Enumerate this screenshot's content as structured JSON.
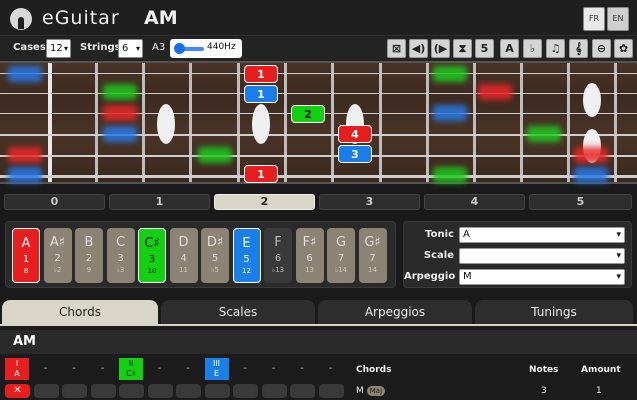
{
  "header": {
    "app_title": "eGuitar",
    "current_key": "AM",
    "lang_fr": "FR",
    "lang_en": "EN"
  },
  "toolbar": {
    "cases_label": "Cases",
    "cases_value": "12",
    "strings_label": "Strings",
    "strings_value": "6",
    "tuning_note": "A3",
    "tuning_freq": "440Hz",
    "tool_icons": [
      "mute-icon",
      "speaker-left-icon",
      "speaker-right-icon",
      "hourglass-icon",
      "number-5-icon",
      "letter-a-icon",
      "flat-icon",
      "music-note-icon",
      "treble-clef-icon",
      "guitar-icon",
      "gear-icon"
    ],
    "tool_glyphs": [
      "⊠",
      "◀)",
      "(▶",
      "⧗",
      "5",
      "A",
      "♭",
      "♫",
      "𝄞",
      "⊖",
      "✿"
    ]
  },
  "positions": [
    "0",
    "1",
    "2",
    "3",
    "4",
    "5"
  ],
  "active_position": "2",
  "fretboard_notes": [
    {
      "label": "1",
      "color": "red"
    },
    {
      "label": "1",
      "color": "blue"
    },
    {
      "label": "2",
      "color": "green"
    },
    {
      "label": "4",
      "color": "red"
    },
    {
      "label": "3",
      "color": "blue"
    },
    {
      "label": "1",
      "color": "red"
    }
  ],
  "notes": [
    {
      "name": "A",
      "degree": "1",
      "interval": "8",
      "style": "red"
    },
    {
      "name": "A♯",
      "degree": "2",
      "interval": "♭2",
      "style": "tan"
    },
    {
      "name": "B",
      "degree": "2",
      "interval": "9",
      "style": "tan"
    },
    {
      "name": "C",
      "degree": "3",
      "interval": "♭3",
      "style": "tan"
    },
    {
      "name": "C♯",
      "degree": "3",
      "interval": "10",
      "style": "green"
    },
    {
      "name": "D",
      "degree": "4",
      "interval": "11",
      "style": "tan"
    },
    {
      "name": "D♯",
      "degree": "5",
      "interval": "♭5",
      "style": "tan"
    },
    {
      "name": "E",
      "degree": "5",
      "interval": "12",
      "style": "blue"
    },
    {
      "name": "F",
      "degree": "6",
      "interval": "♭13",
      "style": "dark"
    },
    {
      "name": "F♯",
      "degree": "6",
      "interval": "13",
      "style": "tan"
    },
    {
      "name": "G",
      "degree": "7",
      "interval": "♭14",
      "style": "tan"
    },
    {
      "name": "G♯",
      "degree": "7",
      "interval": "14",
      "style": "tan"
    }
  ],
  "selects": {
    "tonic_label": "Tonic",
    "tonic_value": "A",
    "scale_label": "Scale",
    "scale_value": "",
    "arpeggio_label": "Arpeggio",
    "arpeggio_value": "M"
  },
  "tabs": [
    "Chords",
    "Scales",
    "Arpeggios",
    "Tunings"
  ],
  "active_tab": "Chords",
  "chord": {
    "name": "AM",
    "degrees": [
      {
        "roman": "I",
        "note": "A",
        "color": "red"
      },
      {
        "roman": "II",
        "note": "C♯",
        "color": "green"
      },
      {
        "roman": "III",
        "note": "E",
        "color": "blue"
      }
    ],
    "dash": "-",
    "remove_glyph": "✕",
    "columns": {
      "chords": "Chords",
      "notes": "Notes",
      "amount": "Amount"
    },
    "row": {
      "chords": "M",
      "badge": "Maj",
      "notes": "3",
      "amount": "1"
    }
  }
}
